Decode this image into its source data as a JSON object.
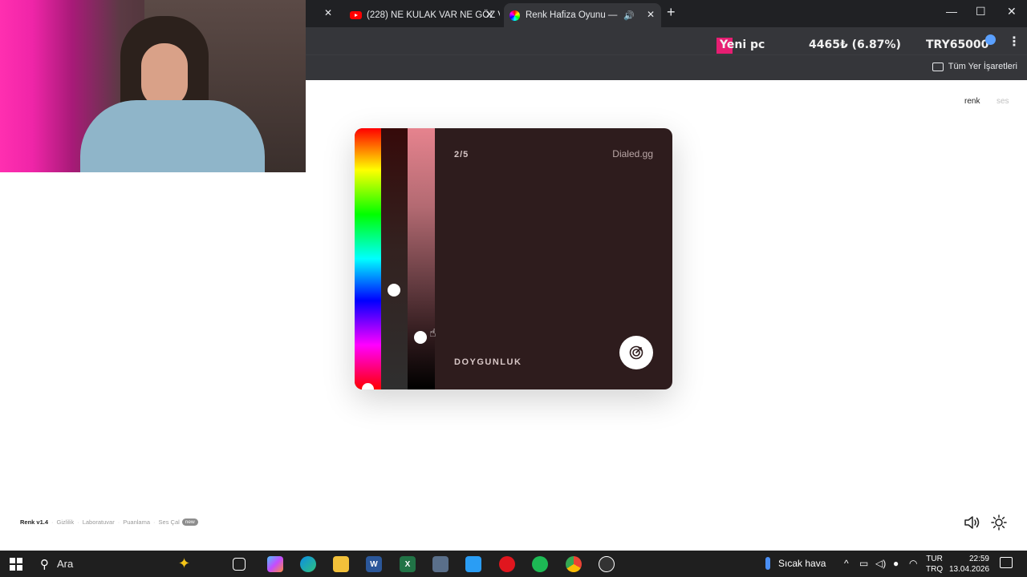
{
  "browser": {
    "tabs": [
      {
        "title": "(228) NE KULAK VAR NE GÖZ V",
        "favicon": "youtube-icon"
      },
      {
        "title": "Renk Hafiza Oyunu — Renk",
        "favicon": "color-wheel-icon",
        "active": true,
        "audio": true
      }
    ],
    "new_tab": "+",
    "window": {
      "minimize": "—",
      "maximize": "☐",
      "close": "✕"
    },
    "tab_close": "✕",
    "ticker": {
      "name": "Yeni pc",
      "price": "4465₺ (6.87%)",
      "target": "TRY65000"
    },
    "menu": "⋮",
    "bookmarks_all": "Tüm Yer İşaretleri"
  },
  "page": {
    "nav": {
      "renk": "renk",
      "ses": "ses"
    },
    "game": {
      "round": "2/5",
      "brand": "Dialed.gg",
      "mode_label": "DOYGUNLUK",
      "hue_level": 1.0,
      "saturation_level": 0.62,
      "brightness_level": 0.8,
      "background_color": "#2e1c1d"
    },
    "footer": {
      "version": "Renk v1.4",
      "links": [
        "Gizlilik",
        "Laboratuvar",
        "Puanlama",
        "Ses Çal"
      ],
      "new_badge": "new"
    }
  },
  "taskbar": {
    "search_placeholder": "Ara",
    "weather": "Sıcak hava",
    "lang_top": "TUR",
    "lang_bottom": "TRQ",
    "time": "22:59",
    "date": "13.04.2026"
  },
  "colors": {
    "accent_pink": "#e61e72",
    "chrome_dark": "#35363a"
  }
}
